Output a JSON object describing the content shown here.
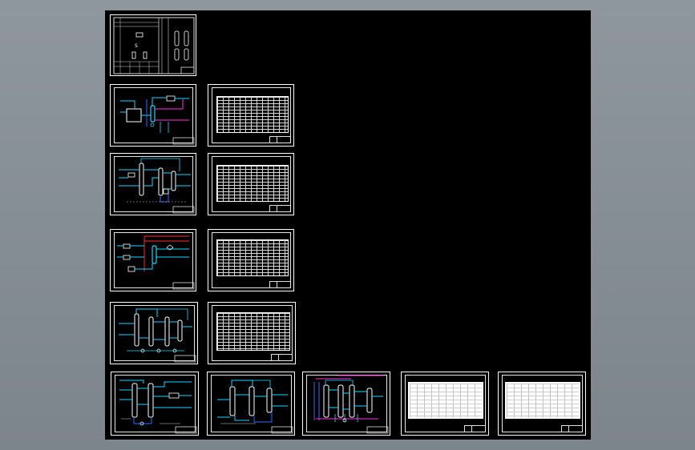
{
  "app": {
    "title": "",
    "colors": {
      "app_background": "#8a9299",
      "drawing_canvas": "#000000",
      "sheet_border": "#ffffff",
      "pipe_cyan": "#18d6ff",
      "pipe_blue": "#2f6bff",
      "pipe_magenta": "#ff2fd6",
      "pipe_red": "#ff3030",
      "equipment_white": "#ffffff",
      "table_white": "#ffffff"
    }
  },
  "canvas": {
    "description_items": [
      {
        "id": "cover-sheet",
        "kind": "cover"
      },
      {
        "id": "pfd-sheet-1",
        "kind": "flow-diagram"
      },
      {
        "id": "table-sheet-1",
        "kind": "data-table"
      },
      {
        "id": "pfd-sheet-2",
        "kind": "flow-diagram"
      },
      {
        "id": "table-sheet-2",
        "kind": "data-table"
      },
      {
        "id": "pfd-sheet-3",
        "kind": "flow-diagram"
      },
      {
        "id": "table-sheet-3",
        "kind": "data-table"
      },
      {
        "id": "pfd-sheet-4",
        "kind": "flow-diagram"
      },
      {
        "id": "table-sheet-4",
        "kind": "data-table"
      },
      {
        "id": "pfd-sheet-5",
        "kind": "flow-diagram"
      },
      {
        "id": "pfd-sheet-6",
        "kind": "flow-diagram"
      },
      {
        "id": "pfd-sheet-7",
        "kind": "flow-diagram"
      },
      {
        "id": "table-sheet-5",
        "kind": "white-table"
      },
      {
        "id": "table-sheet-6",
        "kind": "white-table"
      }
    ]
  }
}
